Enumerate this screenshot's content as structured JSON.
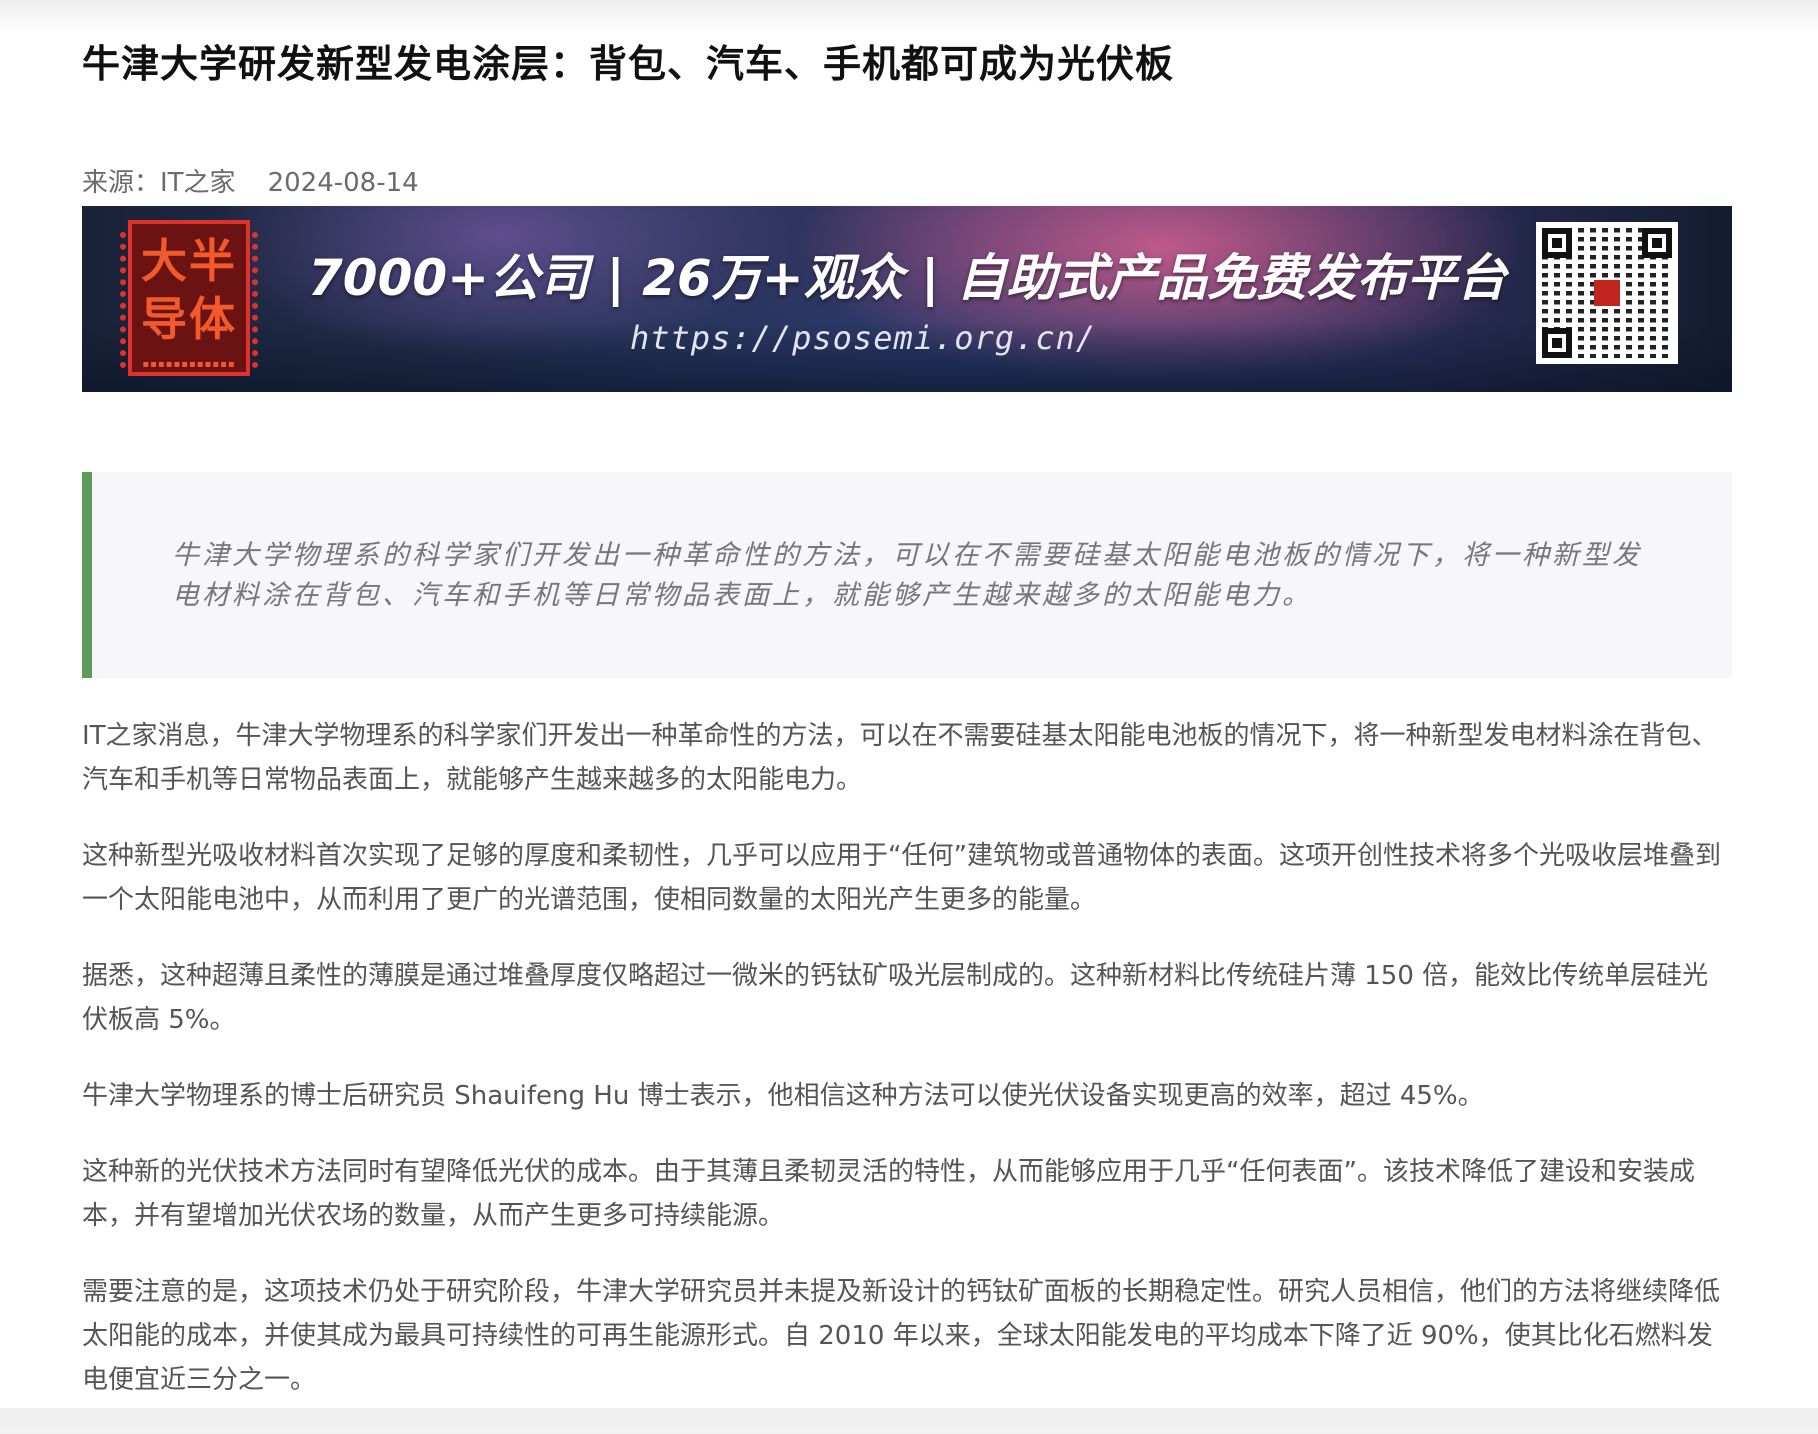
{
  "article": {
    "title": "牛津大学研发新型发电涂层：背包、汽车、手机都可成为光伏板",
    "source": "来源：IT之家",
    "date": "2024-08-14"
  },
  "banner": {
    "logo_text": "大半导体",
    "headline": "7000+公司 | 26万+观众 | 自助式产品免费发布平台",
    "url": "https://psosemi.org.cn/",
    "qr_icon": "qr-code-icon",
    "colors": {
      "logo_red": "#e1312d",
      "glow_pink": "#d66092",
      "deep_blue": "#1a2238"
    }
  },
  "quote": {
    "text": "牛津大学物理系的科学家们开发出一种革命性的方法，可以在不需要硅基太阳能电池板的情况下，将一种新型发电材料涂在背包、汽车和手机等日常物品表面上，就能够产生越来越多的太阳能电力。",
    "accent_color": "#5f9a5a"
  },
  "paragraphs": [
    "IT之家消息，牛津大学物理系的科学家们开发出一种革命性的方法，可以在不需要硅基太阳能电池板的情况下，将一种新型发电材料涂在背包、汽车和手机等日常物品表面上，就能够产生越来越多的太阳能电力。",
    "这种新型光吸收材料首次实现了足够的厚度和柔韧性，几乎可以应用于“任何”建筑物或普通物体的表面。这项开创性技术将多个光吸收层堆叠到一个太阳能电池中，从而利用了更广的光谱范围，使相同数量的太阳光产生更多的能量。",
    "据悉，这种超薄且柔性的薄膜是通过堆叠厚度仅略超过一微米的钙钛矿吸光层制成的。这种新材料比传统硅片薄 150 倍，能效比传统单层硅光伏板高 5%。",
    "牛津大学物理系的博士后研究员 Shauifeng Hu 博士表示，他相信这种方法可以使光伏设备实现更高的效率，超过 45%。",
    "这种新的光伏技术方法同时有望降低光伏的成本。由于其薄且柔韧灵活的特性，从而能够应用于几乎“任何表面”。该技术降低了建设和安装成本，并有望增加光伏农场的数量，从而产生更多可持续能源。",
    "需要注意的是，这项技术仍处于研究阶段，牛津大学研究员并未提及新设计的钙钛矿面板的长期稳定性。研究人员相信，他们的方法将继续降低太阳能的成本，并使其成为最具可持续性的可再生能源形式。自 2010 年以来，全球太阳能发电的平均成本下降了近 90%，使其比化石燃料发电便宜近三分之一。"
  ]
}
